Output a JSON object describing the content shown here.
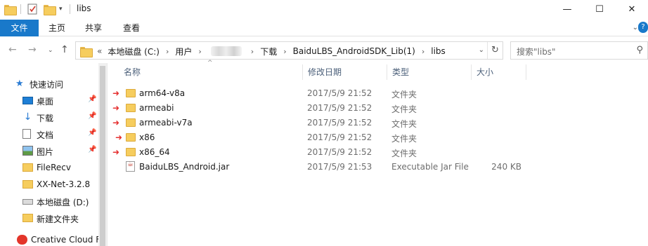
{
  "window": {
    "title": "libs",
    "minimize": "—",
    "maximize": "☐",
    "close": "✕"
  },
  "ribbon": {
    "tabs": [
      "文件",
      "主页",
      "共享",
      "查看"
    ],
    "help": "?"
  },
  "address": {
    "overflow": "«",
    "crumbs": [
      "本地磁盘 (C:)",
      "用户",
      "下载",
      "BaiduLBS_AndroidSDK_Lib(1)",
      "libs"
    ],
    "search_placeholder": "搜索\"libs\""
  },
  "nav": {
    "quick_access": "快速访问",
    "items": [
      {
        "label": "桌面",
        "icon": "desktop-icon",
        "pinned": true
      },
      {
        "label": "下载",
        "icon": "download-icon",
        "pinned": true
      },
      {
        "label": "文档",
        "icon": "document-icon",
        "pinned": true
      },
      {
        "label": "图片",
        "icon": "picture-icon",
        "pinned": true
      },
      {
        "label": "FileRecv",
        "icon": "folder-icon",
        "pinned": false
      },
      {
        "label": "XX-Net-3.2.8",
        "icon": "folder-icon",
        "pinned": false
      },
      {
        "label": "本地磁盘 (D:)",
        "icon": "drive-icon",
        "pinned": false
      },
      {
        "label": "新建文件夹",
        "icon": "folder-icon",
        "pinned": false
      }
    ],
    "creative_cloud": "Creative Cloud F"
  },
  "columns": {
    "name": "名称",
    "date": "修改日期",
    "type": "类型",
    "size": "大小"
  },
  "files": [
    {
      "name": "arm64-v8a",
      "date": "2017/5/9 21:52",
      "type": "文件夹",
      "size": "",
      "icon": "folder-icon",
      "marked": true
    },
    {
      "name": "armeabi",
      "date": "2017/5/9 21:52",
      "type": "文件夹",
      "size": "",
      "icon": "folder-icon",
      "marked": true
    },
    {
      "name": "armeabi-v7a",
      "date": "2017/5/9 21:52",
      "type": "文件夹",
      "size": "",
      "icon": "folder-icon",
      "marked": true
    },
    {
      "name": "x86",
      "date": "2017/5/9 21:52",
      "type": "文件夹",
      "size": "",
      "icon": "folder-icon",
      "marked": true
    },
    {
      "name": "x86_64",
      "date": "2017/5/9 21:52",
      "type": "文件夹",
      "size": "",
      "icon": "folder-icon",
      "marked": true
    },
    {
      "name": "BaiduLBS_Android.jar",
      "date": "2017/5/9 21:53",
      "type": "Executable Jar File",
      "size": "240 KB",
      "icon": "jar-icon",
      "marked": false
    }
  ],
  "colors": {
    "accent": "#1979ca",
    "arrow": "#e53030",
    "folder": "#f6cd5e"
  }
}
